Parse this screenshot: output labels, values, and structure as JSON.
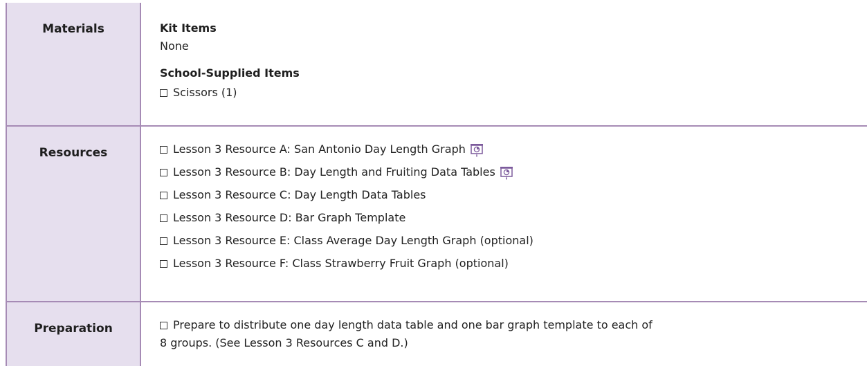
{
  "materials": {
    "label": "Materials",
    "kit_heading": "Kit Items",
    "kit_value": "None",
    "school_heading": "School-Supplied Items",
    "school_items": [
      "Scissors (1)"
    ]
  },
  "resources": {
    "label": "Resources",
    "items": [
      {
        "text": "Lesson 3 Resource A: San Antonio Day Length Graph",
        "icon": "presentation-icon"
      },
      {
        "text": "Lesson 3 Resource B: Day Length and Fruiting Data Tables",
        "icon": "presentation-icon"
      },
      {
        "text": "Lesson 3 Resource C: Day Length Data Tables"
      },
      {
        "text": "Lesson 3 Resource D: Bar Graph Template"
      },
      {
        "text": "Lesson 3 Resource E: Class Average Day Length Graph (optional)"
      },
      {
        "text": "Lesson 3 Resource F: Class Strawberry Fruit Graph (optional)"
      }
    ]
  },
  "preparation": {
    "label": "Preparation",
    "line1": "Prepare to distribute one day length data table and one bar graph template to each of",
    "line2": "8 groups. (See Lesson 3 Resources C and D.)"
  },
  "colors": {
    "border": "#a68bb5",
    "label_bg": "#e6dfee",
    "icon": "#7c5a9c"
  }
}
